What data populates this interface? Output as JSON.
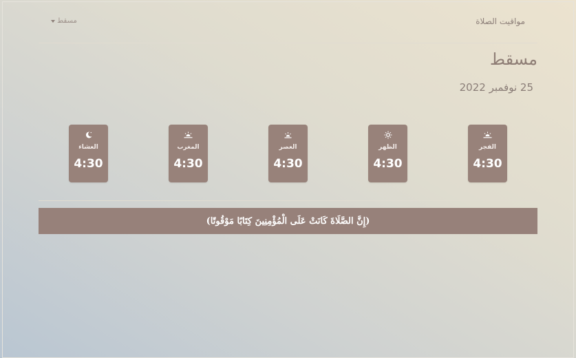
{
  "header": {
    "brand": "مواقيت الصلاة",
    "city_selector": "مسقط"
  },
  "main": {
    "city_title": "مسقط",
    "date": "25 نوفمبر 2022"
  },
  "prayers": [
    {
      "name": "العشاء",
      "time": "4:30",
      "icon": "moon-icon"
    },
    {
      "name": "المغرب",
      "time": "4:30",
      "icon": "sunset-icon"
    },
    {
      "name": "العصر",
      "time": "4:30",
      "icon": "afternoon-sun-icon"
    },
    {
      "name": "الظهر",
      "time": "4:30",
      "icon": "sun-icon"
    },
    {
      "name": "الفجر",
      "time": "4:30",
      "icon": "sunrise-icon"
    }
  ],
  "verse": "(إِنَّ الصَّلَاةَ كَانَتْ عَلَى الْمُؤْمِنِينَ كِتَابًا مَوْقُوتًا)",
  "colors": {
    "card": "#98827a",
    "verse_bar": "#97817a",
    "title_text": "#8e7d75"
  }
}
